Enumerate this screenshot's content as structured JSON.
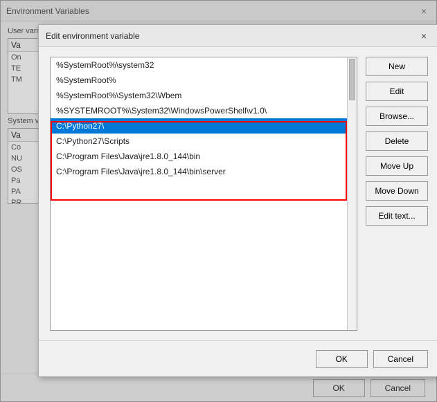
{
  "background": {
    "title": "Environment Variables",
    "close_label": "×",
    "user_section": "User",
    "system_section": "System",
    "ok_label": "OK",
    "cancel_label": "Cancel"
  },
  "dialog": {
    "title": "Edit environment variable",
    "close_label": "×",
    "paths": [
      {
        "value": "%SystemRoot%\\system32",
        "selected": false
      },
      {
        "value": "%SystemRoot%",
        "selected": false
      },
      {
        "value": "%SystemRoot%\\System32\\Wbem",
        "selected": false
      },
      {
        "value": "%SYSTEMROOT%\\System32\\WindowsPowerShell\\v1.0\\",
        "selected": false
      },
      {
        "value": "C:\\Python27\\",
        "selected": true
      },
      {
        "value": "C:\\Python27\\Scripts",
        "selected": false
      },
      {
        "value": "C:\\Program Files\\Java\\jre1.8.0_144\\bin",
        "selected": false
      },
      {
        "value": "C:\\Program Files\\Java\\jre1.8.0_144\\bin\\server",
        "selected": false
      }
    ],
    "buttons": {
      "new": "New",
      "edit": "Edit",
      "browse": "Browse...",
      "delete": "Delete",
      "move_up": "Move Up",
      "move_down": "Move Down",
      "edit_text": "Edit text..."
    },
    "footer": {
      "ok": "OK",
      "cancel": "Cancel"
    }
  },
  "outer_footer": {
    "ok": "OK",
    "cancel": "Cancel"
  }
}
